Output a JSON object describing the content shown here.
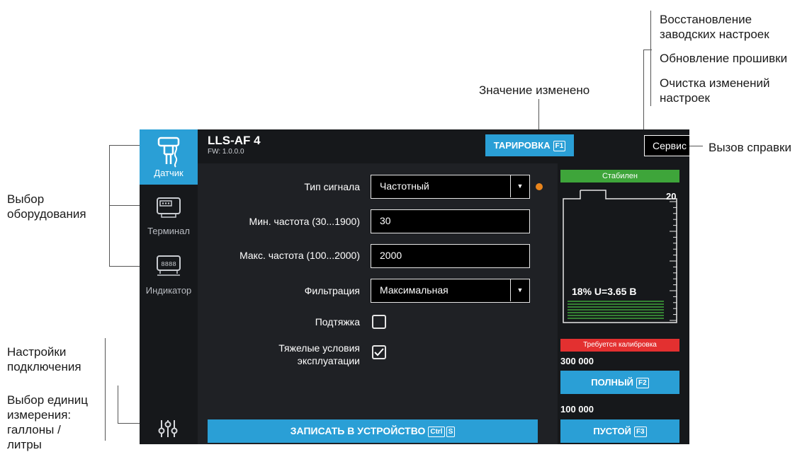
{
  "callouts": {
    "restore_factory": "Восстановление\nзаводских настроек",
    "firmware_update": "Обновление прошивки",
    "clear_changes": "Очистка изменений\nнастроек",
    "value_changed": "Значение изменено",
    "help_call": "Вызов справки",
    "equipment_select": "Выбор\nоборудования",
    "connection_settings": "Настройки\nподключения",
    "units_select": "Выбор единиц\nизмерения:\nгаллоны /\nлитры"
  },
  "sidebar": {
    "items": [
      {
        "label": "Датчик"
      },
      {
        "label": "Терминал"
      },
      {
        "label": "Индикатор"
      }
    ]
  },
  "header": {
    "device_title": "LLS-AF 4",
    "firmware": "FW: 1.0.0.0",
    "calibration_button": "ТАРИРОВКА",
    "calibration_key": "F1",
    "service_button": "Сервис",
    "help": "?"
  },
  "form": {
    "signal_type_label": "Тип сигнала",
    "signal_type_value": "Частотный",
    "min_freq_label": "Мин. частота (30...1900)",
    "min_freq_value": "30",
    "max_freq_label": "Макс. частота (100...2000)",
    "max_freq_value": "2000",
    "filter_label": "Фильтрация",
    "filter_value": "Максимальная",
    "pullup_label": "Подтяжка",
    "pullup_checked": false,
    "heavy_label_1": "Тяжелые условия",
    "heavy_label_2": "эксплуатации",
    "heavy_checked": true
  },
  "write_button": {
    "label": "ЗАПИСАТЬ В УСТРОЙСТВО",
    "key1": "Ctrl",
    "key2": "S"
  },
  "tank": {
    "status": "Стабилен",
    "max_scale": "20",
    "fill_percent": 18,
    "reading": "18% U=3.65 В",
    "calibration_warning": "Требуется калибровка",
    "full_value": "300 000",
    "full_button": "ПОЛНЫЙ",
    "full_key": "F2",
    "empty_value": "100 000",
    "empty_button": "ПУСТОЙ",
    "empty_key": "F3"
  },
  "colors": {
    "accent": "#2a9fd6",
    "stable": "#3ea53a",
    "warning": "#e33030",
    "changed_dot": "#e8841c"
  }
}
